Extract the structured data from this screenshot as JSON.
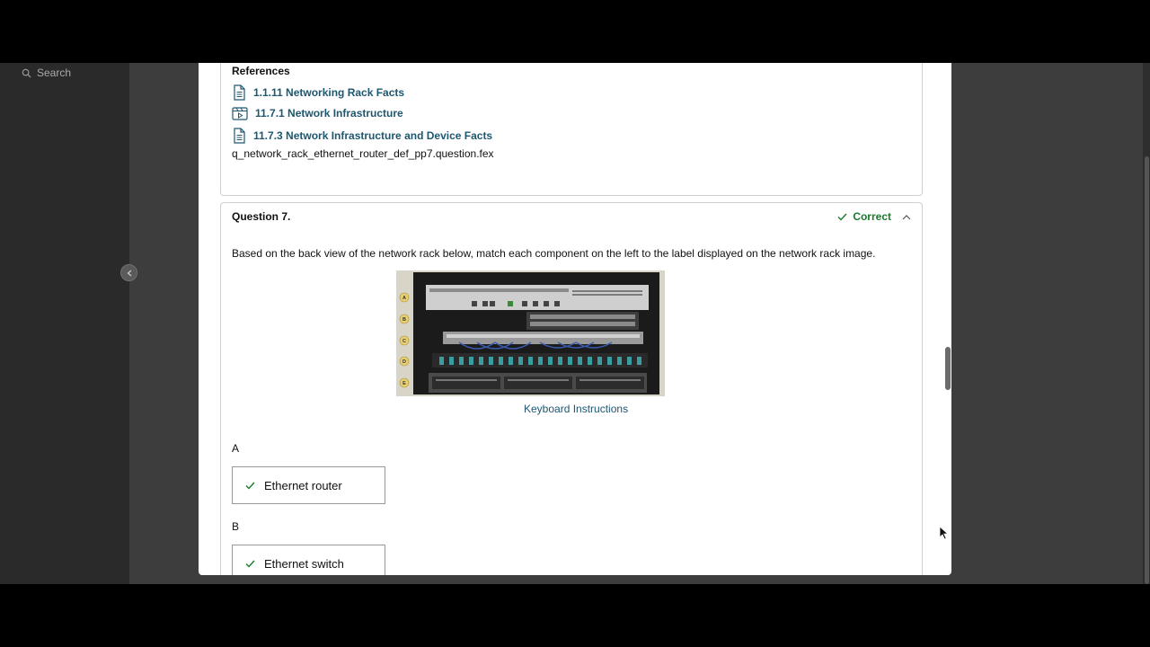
{
  "sidebar": {
    "search_label": "Search"
  },
  "references": {
    "heading": "References",
    "items": [
      {
        "icon": "document-icon",
        "label": "1.1.11 Networking Rack Facts"
      },
      {
        "icon": "video-icon",
        "label": "11.7.1 Network Infrastructure"
      },
      {
        "icon": "document-icon",
        "label": "11.7.3 Network Infrastructure and Device Facts"
      }
    ],
    "filename": "q_network_rack_ethernet_router_def_pp7.question.fex"
  },
  "question": {
    "title": "Question 7.",
    "status": "Correct",
    "prompt": "Based on the back view of the network rack below, match each component on the left to the label displayed on the network rack image.",
    "rack_labels": [
      "A",
      "B",
      "C",
      "D",
      "E"
    ],
    "keyboard_link": "Keyboard Instructions",
    "answers": [
      {
        "slot": "A",
        "value": "Ethernet router"
      },
      {
        "slot": "B",
        "value": "Ethernet switch"
      }
    ]
  },
  "colors": {
    "correct": "#1a7a2e",
    "link": "#1d5770",
    "sidebar": "#2a2a2a",
    "backdrop": "#3d3d3d"
  }
}
